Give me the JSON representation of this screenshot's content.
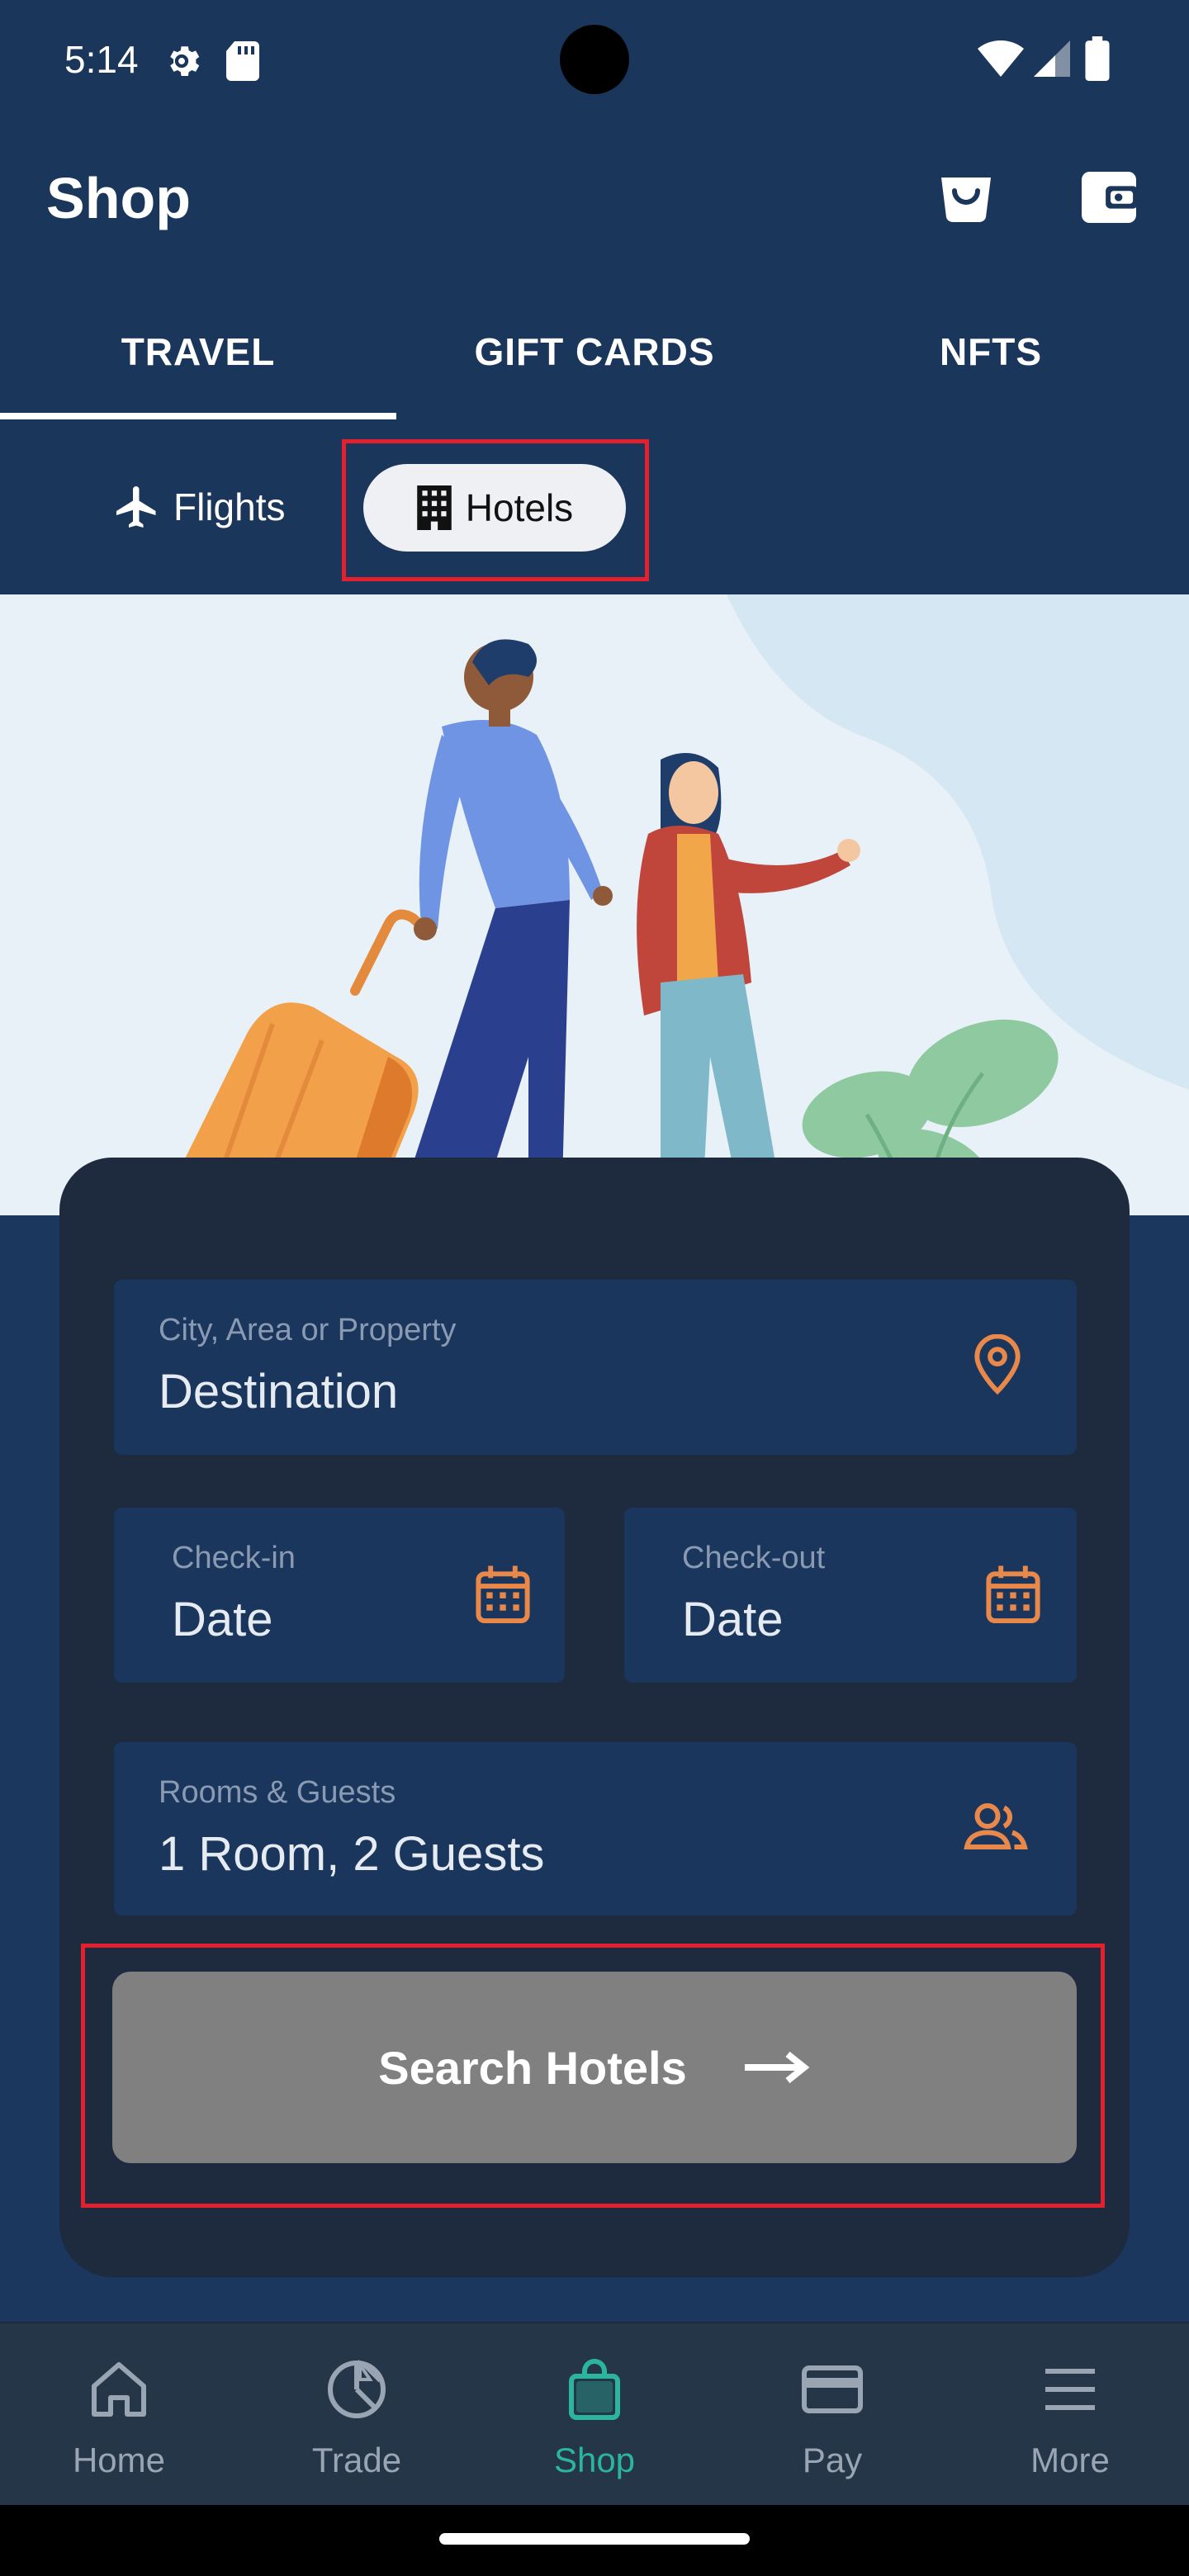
{
  "status_bar": {
    "time": "5:14"
  },
  "app_bar": {
    "title": "Shop"
  },
  "tabs": [
    {
      "label": "TRAVEL",
      "selected": true
    },
    {
      "label": "GIFT CARDS",
      "selected": false
    },
    {
      "label": "NFTS",
      "selected": false
    }
  ],
  "travel_type": {
    "flights_label": "Flights",
    "hotels_label": "Hotels",
    "selected": "Hotels"
  },
  "form": {
    "destination": {
      "label": "City, Area or Property",
      "value": "Destination"
    },
    "check_in": {
      "label": "Check-in",
      "value": "Date"
    },
    "check_out": {
      "label": "Check-out",
      "value": "Date"
    },
    "rooms_guests": {
      "label": "Rooms & Guests",
      "value": "1 Room, 2 Guests"
    },
    "search_button_label": "Search Hotels"
  },
  "bottom_nav": [
    {
      "label": "Home",
      "icon": "home-icon",
      "active": false
    },
    {
      "label": "Trade",
      "icon": "pie-chart-icon",
      "active": false
    },
    {
      "label": "Shop",
      "icon": "shopping-bag-icon",
      "active": true
    },
    {
      "label": "Pay",
      "icon": "card-icon",
      "active": false
    },
    {
      "label": "More",
      "icon": "menu-icon",
      "active": false
    }
  ],
  "colors": {
    "primary_bg": "#1b365b",
    "card_bg": "#1e2a3e",
    "field_bg": "#1a365c",
    "accent_orange": "#e8884a",
    "active_teal": "#2bb5a0",
    "highlight_red": "#e3202d"
  }
}
